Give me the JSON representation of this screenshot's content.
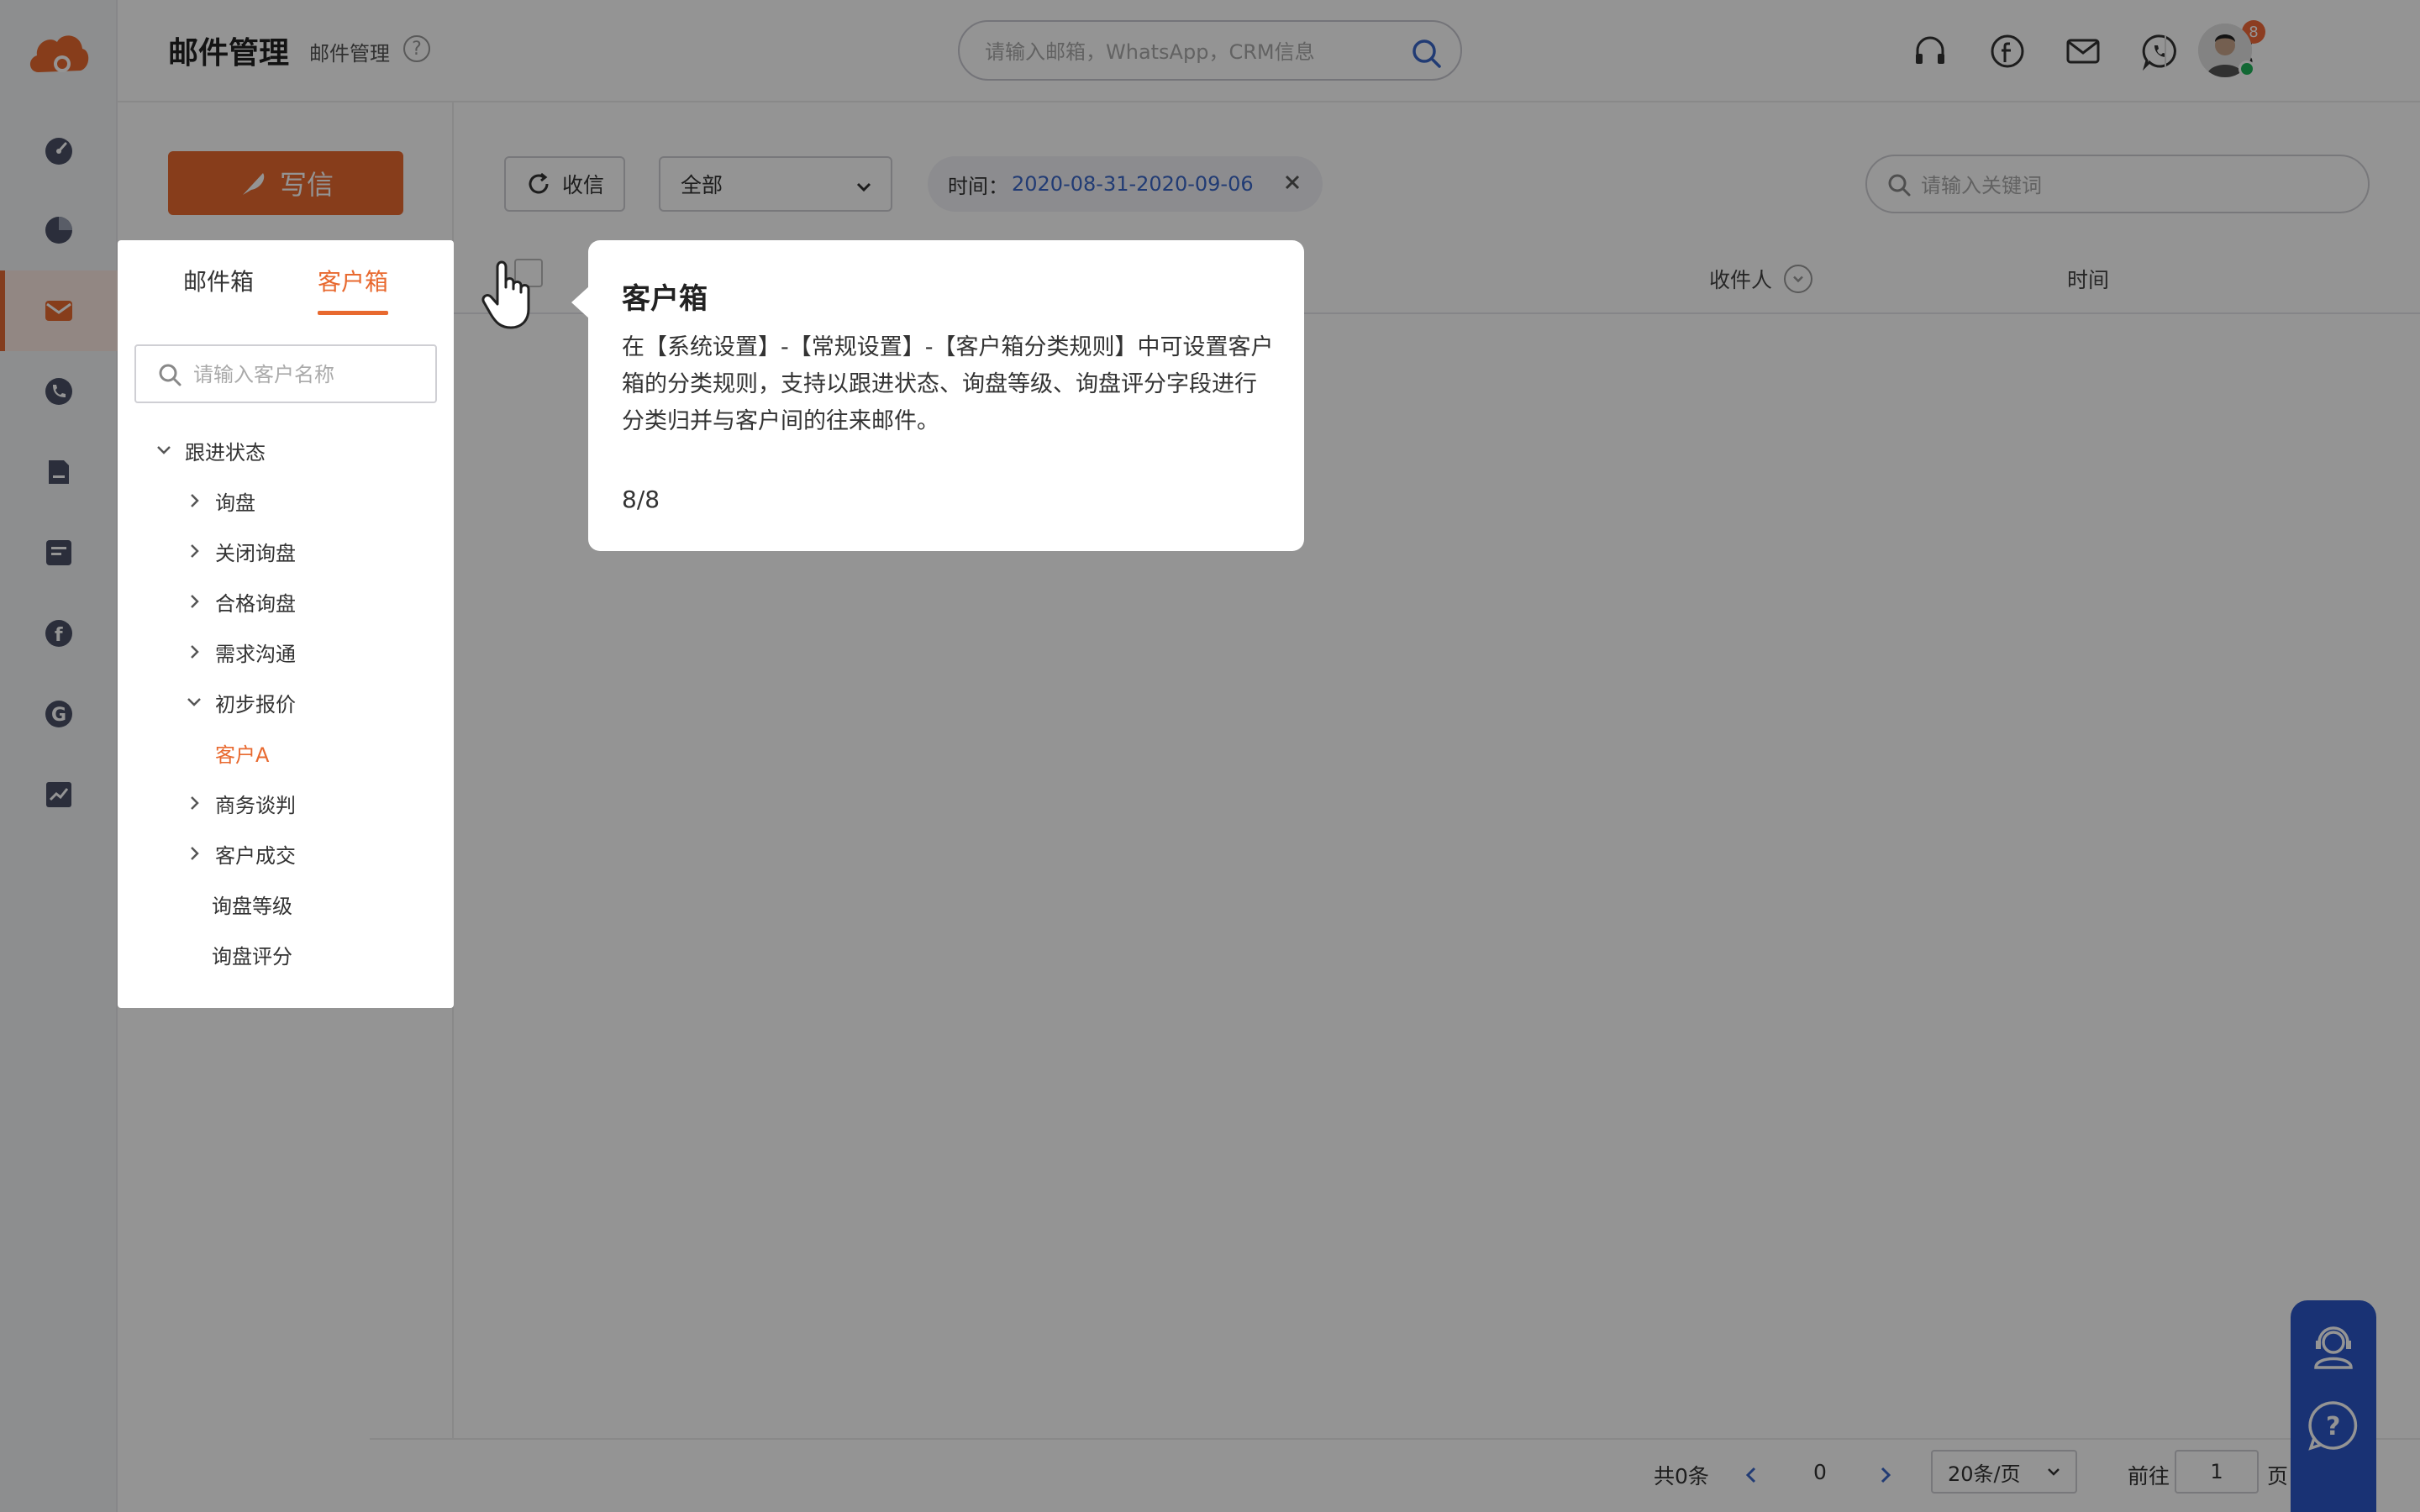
{
  "header": {
    "title": "邮件管理",
    "breadcrumb": "邮件管理",
    "help": "?",
    "search_placeholder": "请输入邮箱，WhatsApp，CRM信息",
    "notification_count": "8"
  },
  "nav": {
    "items": [
      "dashboard-icon",
      "pie-chart-icon",
      "mail-icon",
      "phone-icon",
      "document-icon",
      "message-icon",
      "facebook-icon",
      "google-icon",
      "trend-chart-icon"
    ],
    "active": "mail-icon"
  },
  "toolbar": {
    "compose_label": "写信",
    "receive_label": "收信",
    "filter_value": "全部",
    "time_label": "时间：",
    "time_value": "2020-08-31-2020-09-06",
    "keyword_placeholder": "请输入关键词"
  },
  "table": {
    "columns": [
      "收件人",
      "时间"
    ]
  },
  "pagination": {
    "total": "共0条",
    "current": "0",
    "per_page": "20条/页",
    "goto_label": "前往",
    "goto_value": "1",
    "page_suffix": "页"
  },
  "box_panel": {
    "tabs": [
      "邮件箱",
      "客户箱"
    ],
    "active_tab": "客户箱",
    "search_placeholder": "请输入客户名称",
    "tree": {
      "root": "跟进状态",
      "items": [
        "询盘",
        "关闭询盘",
        "合格询盘",
        "需求沟通",
        "初步报价",
        "客户A",
        "商务谈判",
        "客户成交",
        "询盘等级",
        "询盘评分"
      ]
    }
  },
  "tooltip": {
    "title": "客户箱",
    "body": "在【系统设置】-【常规设置】-【客户箱分类规则】中可设置客户箱的分类规则，支持以跟进状态、询盘等级、询盘评分字段进行分类归并与客户间的往来邮件。",
    "step": "8/8"
  },
  "colors": {
    "accent": "#e8692f",
    "link": "#3a66c8",
    "help_widget": "#2c56c8"
  }
}
